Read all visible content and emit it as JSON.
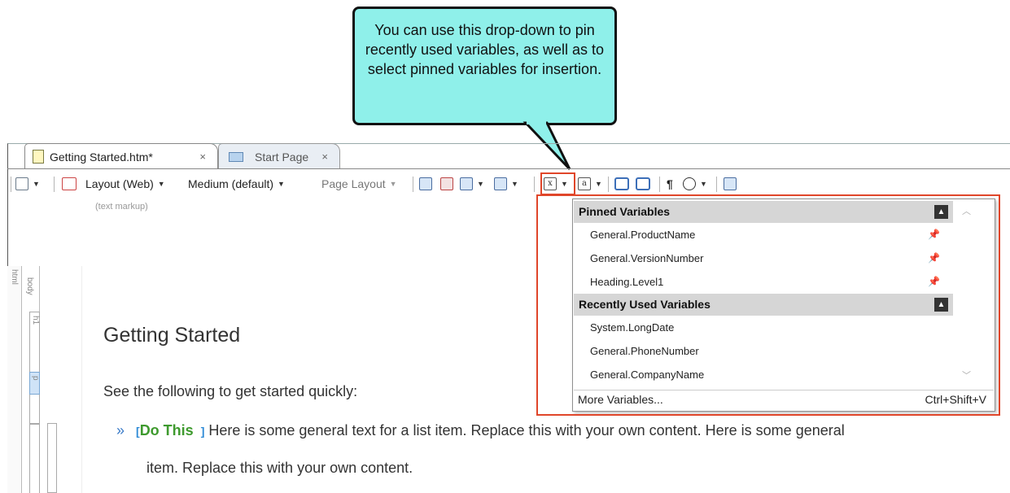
{
  "callout": {
    "text": "You can use this drop-down to pin recently used variables, as well as to select pinned variables for insertion."
  },
  "tabs": [
    {
      "label": "Getting Started.htm*",
      "close": "×"
    },
    {
      "label": "Start Page",
      "close": "×"
    }
  ],
  "toolbar": {
    "layout_label": "Layout (Web)",
    "medium_label": "Medium (default)",
    "page_layout_label": "Page Layout",
    "pilcrow": "¶"
  },
  "editor": {
    "text_markup_label": "(text markup)",
    "html_label": "html",
    "body_label": "body",
    "h1_marker": "h1",
    "p_marker": "p",
    "title": "Getting Started",
    "intro": "See the following to get started quickly:",
    "bullet": "»",
    "span_open": "[",
    "span_close": "]",
    "bold_lead": "Do This",
    "bullet_text": "Here is some general text for a list item. Replace this with your own content. Here is some general",
    "bullet_text_cont": "item. Replace this with your own content."
  },
  "dropdown": {
    "pinned_header": "Pinned Variables",
    "pinned": [
      "General.ProductName",
      "General.VersionNumber",
      "Heading.Level1"
    ],
    "recent_header": "Recently Used Variables",
    "recent": [
      "System.LongDate",
      "General.PhoneNumber",
      "General.CompanyName"
    ],
    "more_label": "More Variables...",
    "more_shortcut": "Ctrl+Shift+V"
  },
  "colors": {
    "callout_fill": "#8ff0ea",
    "highlight": "#e0462a",
    "section_header": "#d6d6d6"
  }
}
